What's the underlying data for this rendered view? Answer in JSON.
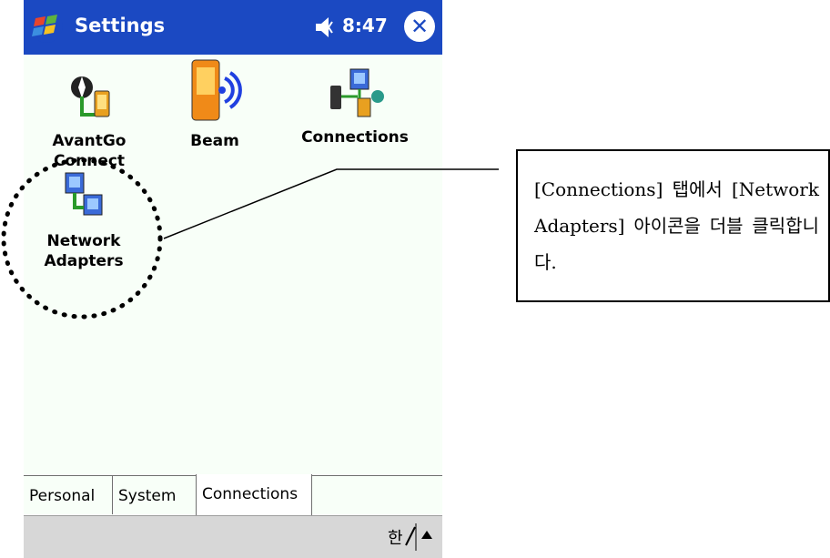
{
  "window": {
    "title": "Settings",
    "time": "8:47",
    "start_icon": "windows-flag-icon",
    "volume_icon": "speaker-icon",
    "close_icon": "close-icon"
  },
  "items": [
    {
      "label_line1": "AvantGo",
      "label_line2": "Connect",
      "icon": "avantgo-icon"
    },
    {
      "label_line1": "Beam",
      "label_line2": "",
      "icon": "beam-icon"
    },
    {
      "label_line1": "Connections",
      "label_line2": "",
      "icon": "connections-icon"
    },
    {
      "label_line1": "Network",
      "label_line2": "Adapters",
      "icon": "network-adapters-icon"
    }
  ],
  "tabs": [
    {
      "label": "Personal",
      "active": false
    },
    {
      "label": "System",
      "active": false
    },
    {
      "label": "Connections",
      "active": true
    }
  ],
  "menubar": {
    "input_icon": "input-panel-icon",
    "arrow_icon": "up-arrow-icon"
  },
  "annotation": {
    "text": "[Connections] 탭에서 [Network Adapters] 아이콘을 더블 클릭합니다."
  },
  "colors": {
    "titlebar": "#1b49c2",
    "highlight_circle": "#000000"
  }
}
